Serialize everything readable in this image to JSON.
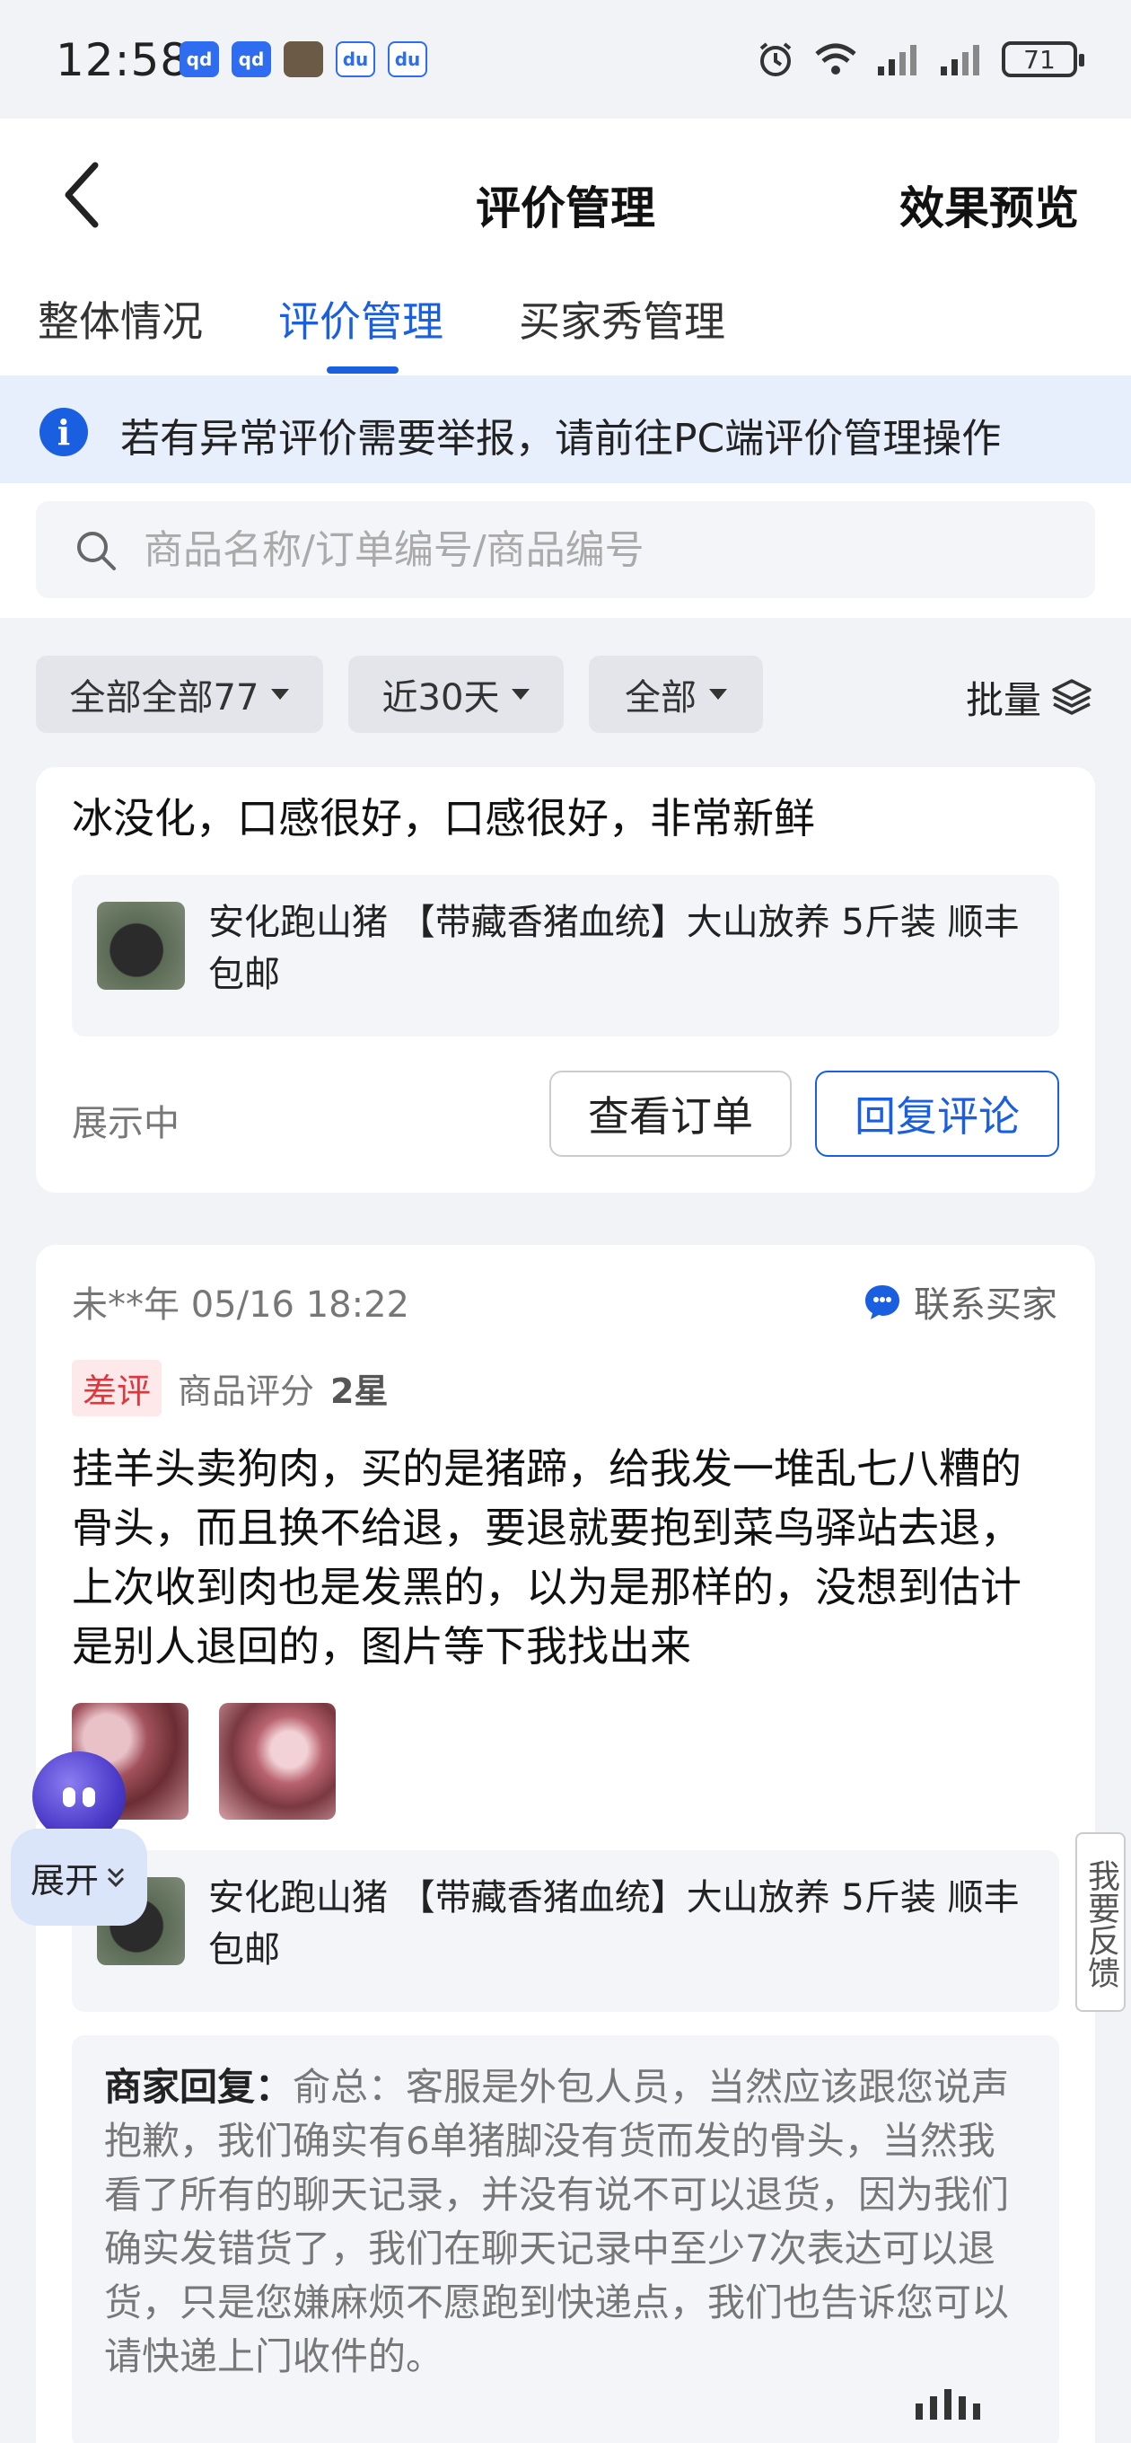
{
  "status_bar": {
    "time": "12:58",
    "apps": [
      {
        "icon": "app-badge-icon",
        "label": "qd",
        "color": "#2e6df0"
      },
      {
        "icon": "app-badge-icon",
        "label": "qd",
        "color": "#2e6df0"
      },
      {
        "icon": "photo-app-icon",
        "label": "",
        "color": "#6b5a46"
      },
      {
        "icon": "baidu-icon",
        "label": "du",
        "color": "#2e6df0"
      },
      {
        "icon": "baidu-icon",
        "label": "du",
        "color": "#2e6df0"
      }
    ],
    "battery": "71"
  },
  "header": {
    "title": "评价管理",
    "preview": "效果预览"
  },
  "tabs": [
    {
      "label": "整体情况",
      "active": false
    },
    {
      "label": "评价管理",
      "active": true
    },
    {
      "label": "买家秀管理",
      "active": false
    }
  ],
  "notice": {
    "icon": "i",
    "text": "若有异常评价需要举报，请前往PC端评价管理操作"
  },
  "search": {
    "placeholder": "商品名称/订单编号/商品编号"
  },
  "filters": {
    "type": "全部全部77",
    "period": "近30天",
    "status": "全部",
    "batch": "批量"
  },
  "reviews": [
    {
      "content": "冰没化，口感很好，口感很好，非常新鲜",
      "product": "安化跑山猪 【带藏香猪血统】大山放养 5斤装 顺丰包邮",
      "status": "展示中",
      "view_order": "查看订单",
      "reply_button": "回复评论"
    },
    {
      "buyer": "未**年 05/16 18:22",
      "contact": "联系买家",
      "tag": "差评",
      "rating_label": "商品评分",
      "rating_value": "2星",
      "content": "挂羊头卖狗肉，买的是猪蹄，给我发一堆乱七八糟的骨头，而且换不给退，要退就要抱到菜鸟驿站去退，上次收到肉也是发黑的，以为是那样的，没想到估计是别人退回的，图片等下我找出来",
      "product": "安化跑山猪 【带藏香猪血统】大山放养 5斤装 顺丰包邮",
      "reply_label": "商家回复：",
      "reply_text": "俞总：客服是外包人员，当然应该跟您说声抱歉，我们确实有6单猪脚没有货而发的骨头，当然我看了所有的聊天记录，并没有说不可以退货，因为我们确实发错货了，我们在聊天记录中至少7次表达可以退货，只是您嫌麻烦不愿跑到快递点，我们也告诉您可以请快递上门收件的。"
    }
  ],
  "floating": {
    "expand": "展开",
    "feedback": "我要反馈"
  },
  "colors": {
    "accent": "#1a5fe0",
    "bad_tag": "#e0363c",
    "background": "#f2f3f6"
  }
}
